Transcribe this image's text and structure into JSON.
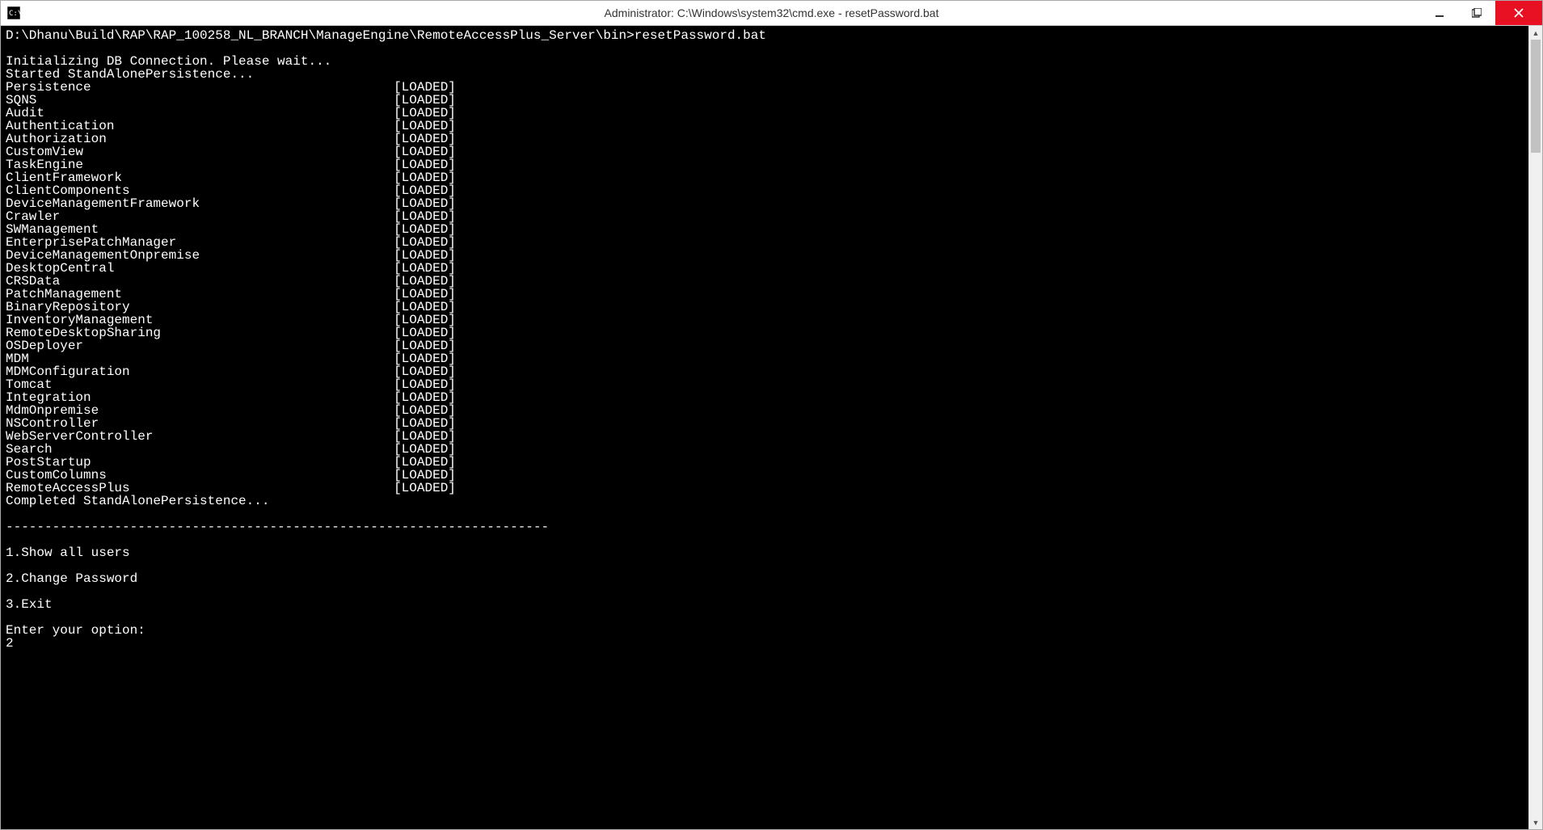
{
  "window": {
    "title": "Administrator: C:\\Windows\\system32\\cmd.exe - resetPassword.bat"
  },
  "terminal": {
    "prompt_line": "D:\\Dhanu\\Build\\RAP\\RAP_100258_NL_BRANCH\\ManageEngine\\RemoteAccessPlus_Server\\bin>resetPassword.bat",
    "initializing": "Initializing DB Connection. Please wait...",
    "started": "Started StandAlonePersistence...",
    "loaded_status": "[LOADED]",
    "modules": [
      "Persistence",
      "SQNS",
      "Audit",
      "Authentication",
      "Authorization",
      "CustomView",
      "TaskEngine",
      "ClientFramework",
      "ClientComponents",
      "DeviceManagementFramework",
      "Crawler",
      "SWManagement",
      "EnterprisePatchManager",
      "DeviceManagementOnpremise",
      "DesktopCentral",
      "CRSData",
      "PatchManagement",
      "BinaryRepository",
      "InventoryManagement",
      "RemoteDesktopSharing",
      "OSDeployer",
      "MDM",
      "MDMConfiguration",
      "Tomcat",
      "Integration",
      "MdmOnpremise",
      "NSController",
      "WebServerController",
      "Search",
      "PostStartup",
      "CustomColumns",
      "RemoteAccessPlus"
    ],
    "completed": "Completed StandAlonePersistence...",
    "separator": "----------------------------------------------------------------------",
    "menu": {
      "opt1": "1.Show all users",
      "opt2": "2.Change Password",
      "opt3": "3.Exit"
    },
    "enter_option": "Enter your option:",
    "user_input": "2"
  }
}
